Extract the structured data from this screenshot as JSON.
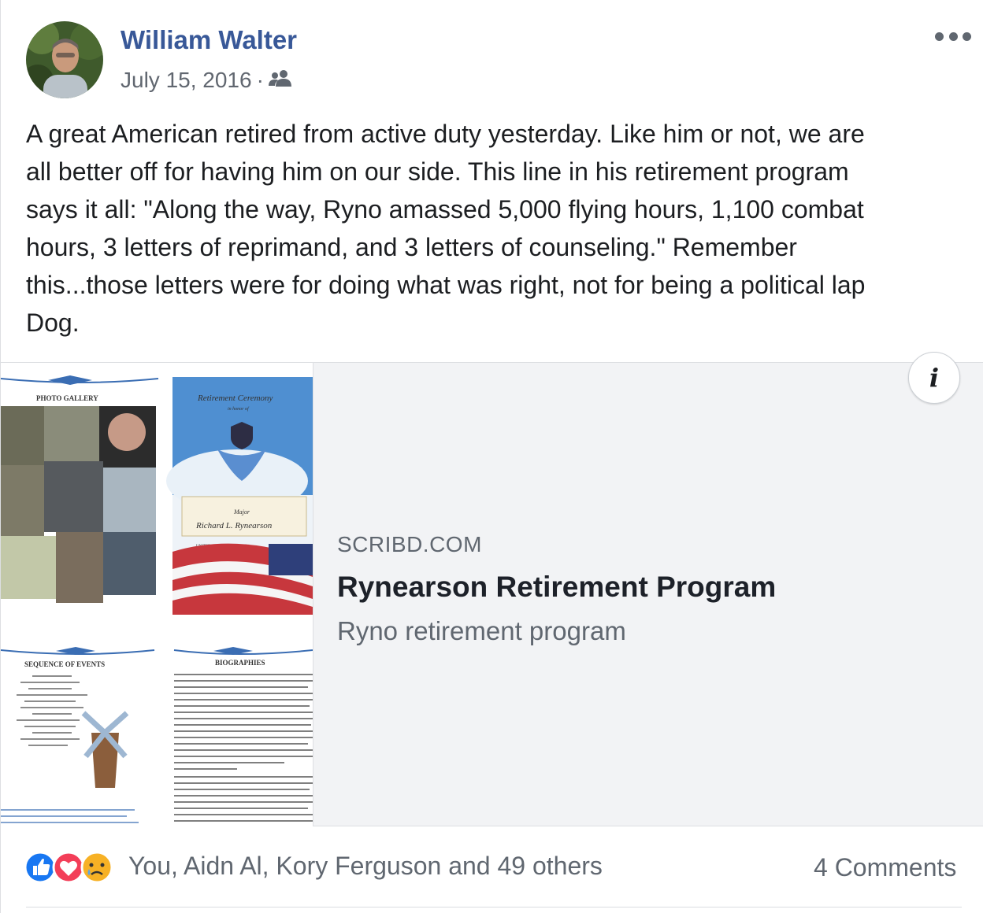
{
  "post": {
    "author": "William Walter",
    "date": "July 15, 2016",
    "separator": "·",
    "audience_icon": "friends-icon",
    "more_icon": "more-options-icon",
    "text": "A great American retired from active duty yesterday. Like him or not, we are\nall better off for having him on our side. This line in his retirement program\nsays it all: \"Along the way, Ryno amassed 5,000 flying hours, 1,100 combat\nhours, 3 letters of reprimand, and 3 letters of counseling.\" Remember\nthis...those letters were for doing what was right, not for being a political lap\nDog."
  },
  "link_card": {
    "domain": "SCRIBD.COM",
    "title": "Rynearson Retirement Program",
    "description": "Ryno retirement program",
    "info_icon": "info-icon",
    "info_glyph": "i",
    "thumbnail": {
      "photo_gallery": "PHOTO GALLERY",
      "ceremony_title": "Retirement Ceremony",
      "ceremony_sub": "in honor of",
      "rank": "Major",
      "name": "Richard L. Rynearson",
      "branch": "UNITED STATES AIR FORCE",
      "sequence": "SEQUENCE OF EVENTS",
      "biographies": "BIOGRAPHIES"
    }
  },
  "footer": {
    "reaction_icons": [
      "like-icon",
      "love-icon",
      "sad-icon"
    ],
    "reactions_text": "You, Aidn Al, Kory Ferguson and 49 others",
    "comments_text": "4 Comments"
  },
  "colors": {
    "author_link": "#385898",
    "secondary_text": "#606770",
    "like_blue": "#1877f2",
    "love_red": "#f33e58",
    "sad_yellow": "#f7b125"
  }
}
